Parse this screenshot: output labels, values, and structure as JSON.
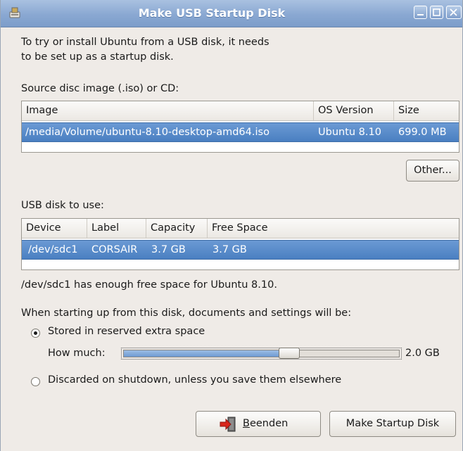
{
  "window": {
    "title": "Make USB Startup Disk",
    "icons": {
      "app": "usb-creator-icon",
      "minimize": "minimize-icon",
      "maximize": "maximize-icon",
      "close": "close-icon"
    }
  },
  "intro": {
    "line1": "To try or install Ubuntu from a USB disk, it needs",
    "line2": "to be set up as a startup disk."
  },
  "source": {
    "label": "Source disc image (.iso) or CD:",
    "columns": [
      "Image",
      "OS Version",
      "Size"
    ],
    "rows": [
      {
        "image": "/media/Volume/ubuntu-8.10-desktop-amd64.iso",
        "os_version": "Ubuntu 8.10",
        "size": "699.0 MB"
      }
    ],
    "other_button": "Other..."
  },
  "usb": {
    "label": "USB disk to use:",
    "columns": [
      "Device",
      "Label",
      "Capacity",
      "Free Space"
    ],
    "rows": [
      {
        "device": "/dev/sdc1",
        "label": "CORSAIR",
        "capacity": "3.7 GB",
        "free_space": "3.7 GB"
      }
    ],
    "status": "/dev/sdc1 has enough free space for Ubuntu 8.10."
  },
  "persistence": {
    "question": "When starting up from this disk, documents and settings will be:",
    "option_stored": "Stored in reserved extra space",
    "how_much_label": "How much:",
    "slider_value_text": "2.0 GB",
    "slider_fraction": 0.61,
    "option_discarded": "Discarded on shutdown, unless you save them elsewhere",
    "selected": "stored"
  },
  "buttons": {
    "quit": "Beenden",
    "quit_mnemonic": "B",
    "quit_rest": "eenden",
    "make": "Make Startup Disk"
  },
  "colors": {
    "selection": "#4a7fc1",
    "titlebar": "#8aa8d2",
    "window_bg": "#efebe7",
    "quit_icon": "#d9261c"
  }
}
